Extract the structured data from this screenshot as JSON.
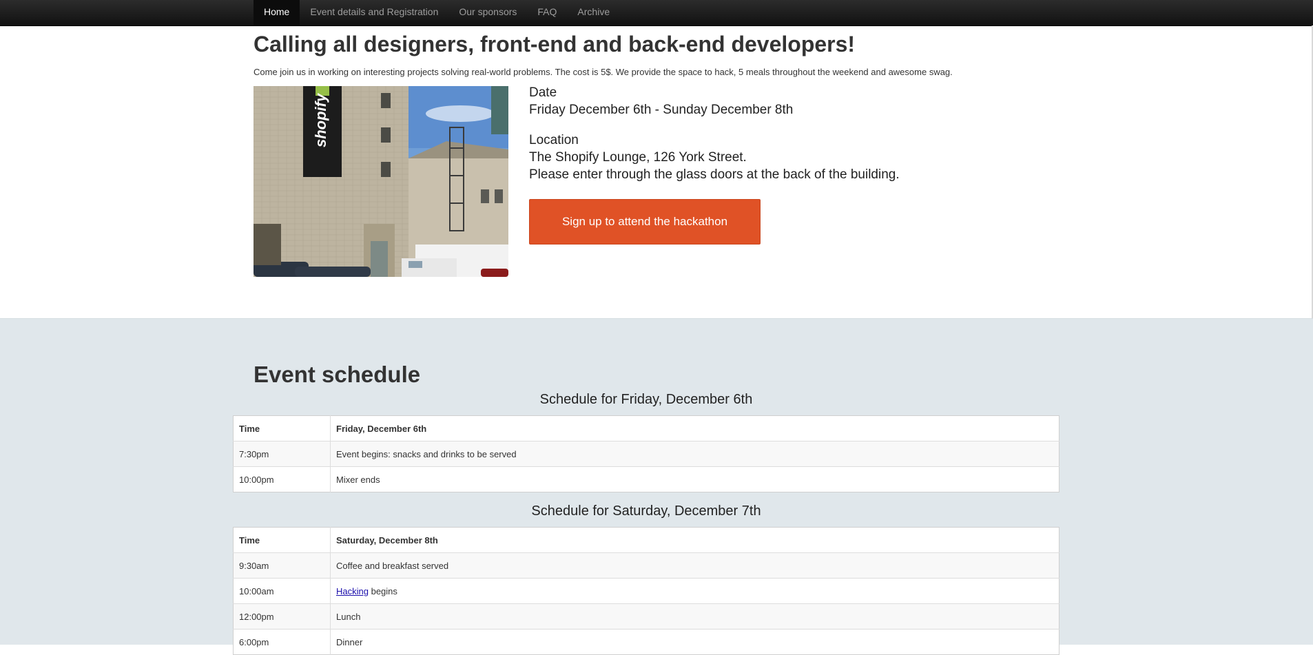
{
  "nav": {
    "items": [
      {
        "label": "Home",
        "active": true
      },
      {
        "label": "Event details and Registration",
        "active": false
      },
      {
        "label": "Our sponsors",
        "active": false
      },
      {
        "label": "FAQ",
        "active": false
      },
      {
        "label": "Archive",
        "active": false
      }
    ]
  },
  "hero": {
    "title": "Calling all designers, front-end and back-end developers!",
    "intro": "Come join us in working on interesting projects solving real-world problems. The cost is 5$. We provide the space to hack, 5 meals throughout the weekend and awesome swag.",
    "photo_banner_text": "shopify",
    "date_label": "Date",
    "date_value": "Friday December 6th - Sunday December 8th",
    "location_label": "Location",
    "location_line1": "The Shopify Lounge, 126 York Street.",
    "location_line2": "Please enter through the glass doors at the back of the building.",
    "signup_label": "Sign up to attend the hackathon",
    "signup_color": "#e05226"
  },
  "schedule": {
    "title": "Event schedule",
    "days": [
      {
        "caption": "Schedule for Friday, December 6th",
        "header": [
          "Time",
          "Friday, December 6th"
        ],
        "rows": [
          [
            "7:30pm",
            "Event begins: snacks and drinks to be served"
          ],
          [
            "10:00pm",
            "Mixer ends"
          ]
        ]
      },
      {
        "caption": "Schedule for Saturday, December 7th",
        "header": [
          "Time",
          "Saturday, December 8th"
        ],
        "rows": [
          [
            "9:30am",
            "Coffee and breakfast served"
          ],
          [
            "10:00am",
            "begins"
          ],
          [
            "12:00pm",
            "Lunch"
          ],
          [
            "6:00pm",
            "Dinner"
          ]
        ],
        "link_text": "Hacking"
      }
    ]
  },
  "colors": {
    "navbar_bg": "#1b1b1b",
    "schedule_bg": "#e0e7eb",
    "accent": "#e05226"
  }
}
